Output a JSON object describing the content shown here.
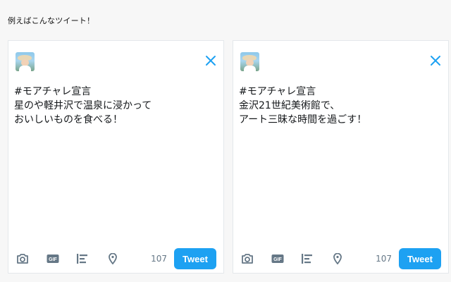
{
  "intro_text": "例えばこんなツイート！",
  "colors": {
    "accent": "#1da1f2",
    "icon": "#657786",
    "text": "#14171a"
  },
  "cards": [
    {
      "text": "#モアチャレ宣言\n星のや軽井沢で温泉に浸かって\nおいしいものを食べる！",
      "counter": "107",
      "tweet_label": "Tweet"
    },
    {
      "text": "#モアチャレ宣言\n金沢21世紀美術館で、\nアート三昧な時間を過ごす！",
      "counter": "107",
      "tweet_label": "Tweet"
    }
  ],
  "icons": {
    "close": "close-icon",
    "camera": "camera-icon",
    "gif": "gif-icon",
    "poll": "poll-icon",
    "location": "location-pin-icon"
  },
  "gif_icon_label": "GIF"
}
